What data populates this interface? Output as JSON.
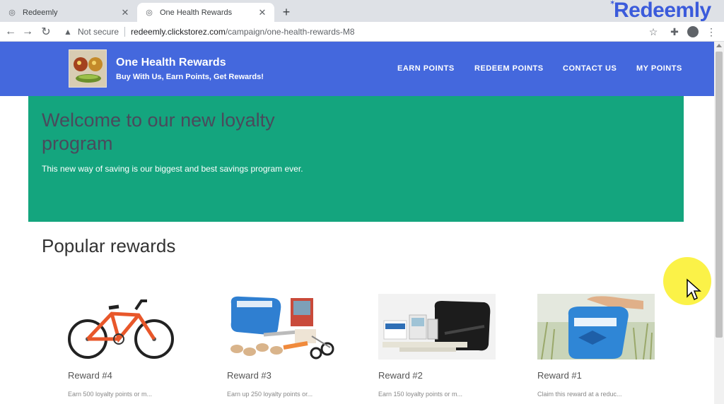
{
  "browser": {
    "tabs": [
      {
        "title": "Redeemly",
        "active": false
      },
      {
        "title": "One Health Rewards",
        "active": true
      }
    ],
    "new_tab": "+",
    "security_label": "Not secure",
    "url_host": "redeemly.clickstorez.com",
    "url_path": "/campaign/one-health-rewards-M8",
    "overlay_brand": "Redeemly"
  },
  "site": {
    "name": "One Health Rewards",
    "tagline": "Buy With Us, Earn Points, Get Rewards!",
    "nav": [
      "EARN POINTS",
      "REDEEM POINTS",
      "CONTACT US",
      "MY POINTS"
    ],
    "header_color": "#4468dd"
  },
  "hero": {
    "title": "Welcome to our new loyalty program",
    "subtitle": "This new way of saving is our biggest and best savings program ever.",
    "bg_color": "#14a57e"
  },
  "rewards": {
    "section_title": "Popular rewards",
    "items": [
      {
        "title": "Reward #4",
        "desc": "Earn 500 loyalty points or m...",
        "image": "bicycle"
      },
      {
        "title": "Reward #3",
        "desc": "Earn up 250 loyalty points or...",
        "image": "first-aid-kit-contents"
      },
      {
        "title": "Reward #2",
        "desc": "Earn 150 loyalty points or m...",
        "image": "glucose-monitor-kit"
      },
      {
        "title": "Reward #1",
        "desc": "Claim this reward at a reduc...",
        "image": "medical-kit-bag"
      }
    ]
  }
}
